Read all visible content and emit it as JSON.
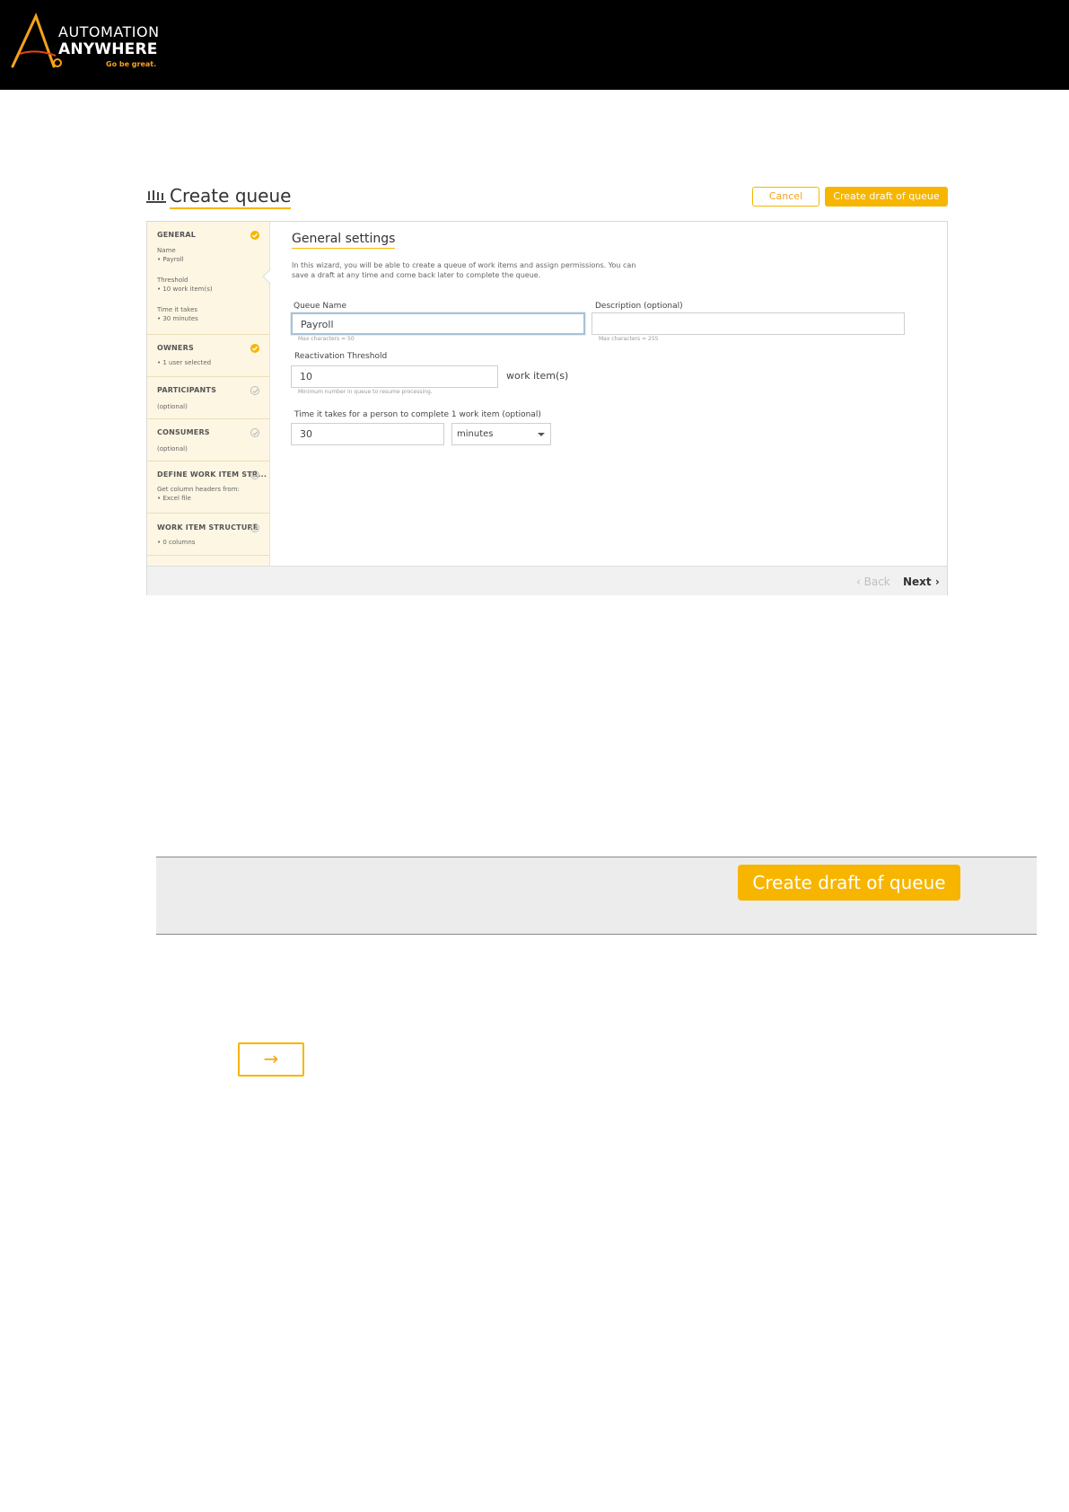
{
  "brand": {
    "line1": "AUTOMATION",
    "line2": "ANYWHERE",
    "tagline": "Go be great.",
    "accent_color": "#f7b500"
  },
  "page": {
    "title": "Create queue",
    "title_icon": "queue-icon",
    "cancel_label": "Cancel",
    "create_draft_label": "Create draft of queue"
  },
  "sidebar": {
    "general": {
      "heading": "GENERAL",
      "status": "complete",
      "name_label": "Name",
      "name_value": "• Payroll",
      "threshold_label": "Threshold",
      "threshold_value": "• 10 work item(s)",
      "time_label": "Time it takes",
      "time_value": "• 30 minutes"
    },
    "owners": {
      "heading": "OWNERS",
      "status": "complete",
      "detail": "• 1 user selected"
    },
    "participants": {
      "heading": "PARTICIPANTS",
      "status": "pending",
      "detail": "(optional)"
    },
    "consumers": {
      "heading": "CONSUMERS",
      "status": "pending",
      "detail": "(optional)"
    },
    "define_structure": {
      "heading": "DEFINE WORK ITEM STR...",
      "status": "pending",
      "detail1": "Get column headers from:",
      "detail2": "• Excel file"
    },
    "work_item_structure": {
      "heading": "WORK ITEM STRUCTURE",
      "status": "pending",
      "detail": "• 0 columns"
    }
  },
  "general_settings": {
    "heading": "General settings",
    "intro": "In this wizard, you will be able to create a queue of work items and assign permissions. You can save a draft at any time and come back later to complete the queue.",
    "queue_name_label": "Queue Name",
    "queue_name_value": "Payroll",
    "queue_name_hint": "Max characters = 50",
    "description_label": "Description (optional)",
    "description_value": "",
    "description_hint": "Max characters = 255",
    "reactivation_label": "Reactivation Threshold",
    "reactivation_value": "10",
    "reactivation_unit": "work item(s)",
    "reactivation_hint": "Minimum number in queue to resume processing.",
    "time_label": "Time it takes for a person to complete 1 work item (optional)",
    "time_value": "30",
    "time_unit_selected": "minutes"
  },
  "footer": {
    "back_label": "Back",
    "next_label": "Next"
  },
  "callout": {
    "create_draft_label": "Create draft of queue",
    "arrow_label": "→"
  }
}
